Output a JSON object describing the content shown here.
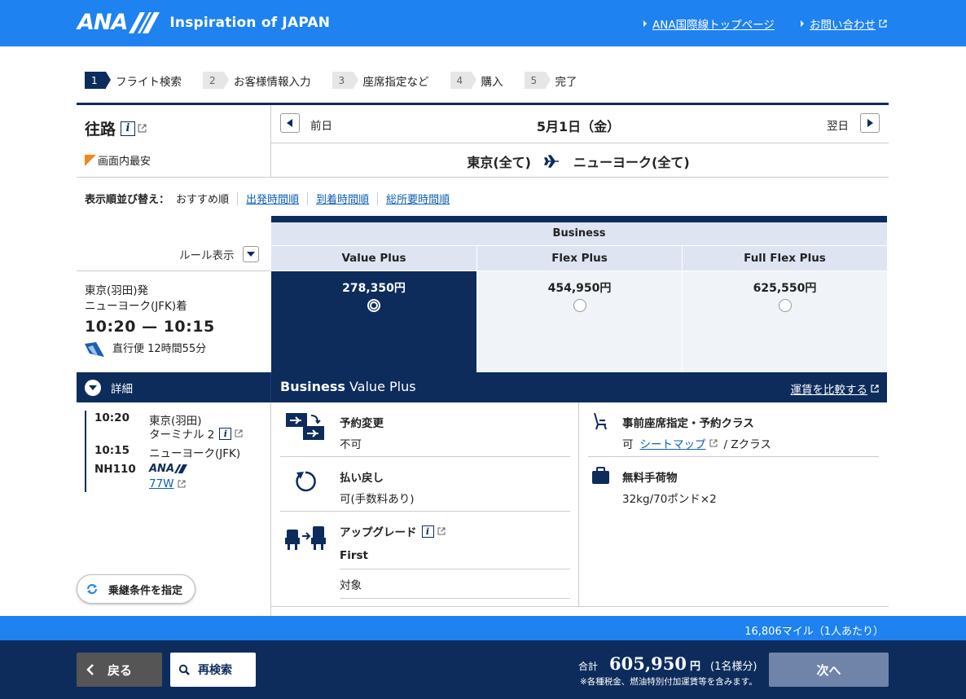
{
  "header": {
    "brand": "ANA",
    "tagline": "Inspiration of JAPAN",
    "link_top": "ANA国際線トップページ",
    "link_contact": "お問い合わせ",
    "bg_color": "#1e82f0"
  },
  "steps": [
    {
      "num": "1",
      "label": "フライト検索",
      "active": true
    },
    {
      "num": "2",
      "label": "お客様情報入力",
      "active": false
    },
    {
      "num": "3",
      "label": "座席指定など",
      "active": false
    },
    {
      "num": "4",
      "label": "購入",
      "active": false
    },
    {
      "num": "5",
      "label": "完了",
      "active": false
    }
  ],
  "route": {
    "title": "往路",
    "cheapest_label": "画面内最安",
    "prev_label": "前日",
    "next_label": "翌日",
    "date": "5月1日（金）",
    "origin": "東京(全て)",
    "destination": "ニューヨーク(全て)"
  },
  "sort": {
    "label": "表示順並び替え：",
    "current": "おすすめ順",
    "options": [
      "出発時間順",
      "到着時間順",
      "総所要時間順"
    ]
  },
  "fare": {
    "cabin": "Business",
    "rule_toggle": "ルール表示",
    "columns": [
      {
        "name": "Value Plus",
        "price": "278,350円",
        "selected": true
      },
      {
        "name": "Flex Plus",
        "price": "454,950円",
        "selected": false
      },
      {
        "name": "Full Flex Plus",
        "price": "625,550円",
        "selected": false
      }
    ]
  },
  "flight": {
    "departure": "東京(羽田)発",
    "arrival": "ニューヨーク(JFK)着",
    "times": "10:20 — 10:15",
    "direct": "直行便 12時間55分"
  },
  "details": {
    "toggle_label": "詳細",
    "title_bold": "Business",
    "title_rest": " Value Plus",
    "compare_link": "運賃を比較する",
    "itinerary": {
      "dep_time": "10:20",
      "dep_place": "東京(羽田)",
      "dep_terminal": "ターミナル 2",
      "arr_time": "10:15",
      "arr_place": "ニューヨーク(JFK)",
      "flight_no": "NH110",
      "carrier": "ANA",
      "aircraft": "77W"
    },
    "features": {
      "change": {
        "title": "予約変更",
        "value": "不可"
      },
      "refund": {
        "title": "払い戻し",
        "value": "可(手数料あり)"
      },
      "upgrade": {
        "title": "アップグレード",
        "class": "First",
        "value": "対象"
      },
      "seat": {
        "title": "事前座席指定・予約クラス",
        "value_pre": "可",
        "link": "シートマップ",
        "value_post": "/ Zクラス"
      },
      "baggage": {
        "title": "無料手荷物",
        "value": "32kg/70ポンド×2"
      }
    },
    "resume_button": "乗継条件を指定"
  },
  "footer": {
    "miles": "16,806マイル（1人あたり）",
    "back": "戻る",
    "research": "再検索",
    "total_label": "合計",
    "total_amount": "605,950",
    "total_yen": "円",
    "total_per": "(1名様分)",
    "note": "※各種税金、燃油特別付加運賃等を含みます。",
    "next": "次へ"
  }
}
